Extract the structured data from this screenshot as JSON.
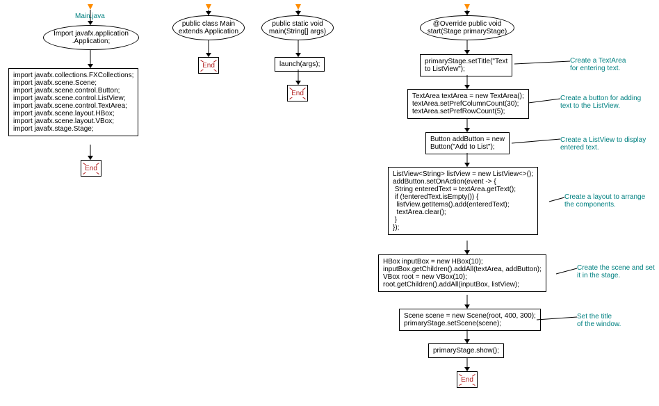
{
  "file_label": "Main.java",
  "col1": {
    "ellipse": "Import javafx.application\n.Application;",
    "box": "import javafx.collections.FXCollections;\nimport javafx.scene.Scene;\nimport javafx.scene.control.Button;\nimport javafx.scene.control.ListView;\nimport javafx.scene.control.TextArea;\nimport javafx.scene.layout.HBox;\nimport javafx.scene.layout.VBox;\nimport javafx.stage.Stage;"
  },
  "col2": {
    "ellipse": "public class Main\nextends Application"
  },
  "col3": {
    "ellipse": "public static void\nmain(String[] args)",
    "box": "launch(args);"
  },
  "col4": {
    "ellipse": "@Override public void\nstart(Stage primaryStage)",
    "box1": "primaryStage.setTitle(\"Text\nto ListView\");",
    "box2": "TextArea textArea = new TextArea();\ntextArea.setPrefColumnCount(30);\ntextArea.setPrefRowCount(5);",
    "box3": "Button addButton = new\nButton(\"Add to List\");",
    "box4": "ListView<String> listView = new ListView<>();\naddButton.setOnAction(event -> {\n String enteredText = textArea.getText();\n if (!enteredText.isEmpty()) {\n  listView.getItems().add(enteredText);\n  textArea.clear();\n }\n});",
    "box5": "HBox inputBox = new HBox(10);\ninputBox.getChildren().addAll(textArea, addButton);\nVBox root = new VBox(10);\nroot.getChildren().addAll(inputBox, listView);",
    "box6": "Scene scene = new Scene(root, 400, 300);\nprimaryStage.setScene(scene);",
    "box7": "primaryStage.show();"
  },
  "annotations": {
    "a1": "Create a TextArea\nfor entering text.",
    "a2": "Create a button for adding\ntext to the ListView.",
    "a3": "Create a ListView to display\nentered text.",
    "a4": "Create a layout to arrange\nthe components.",
    "a5": "Create the scene and set\nit in the stage.",
    "a6": "Set the title\nof the window."
  },
  "end_label": "End"
}
